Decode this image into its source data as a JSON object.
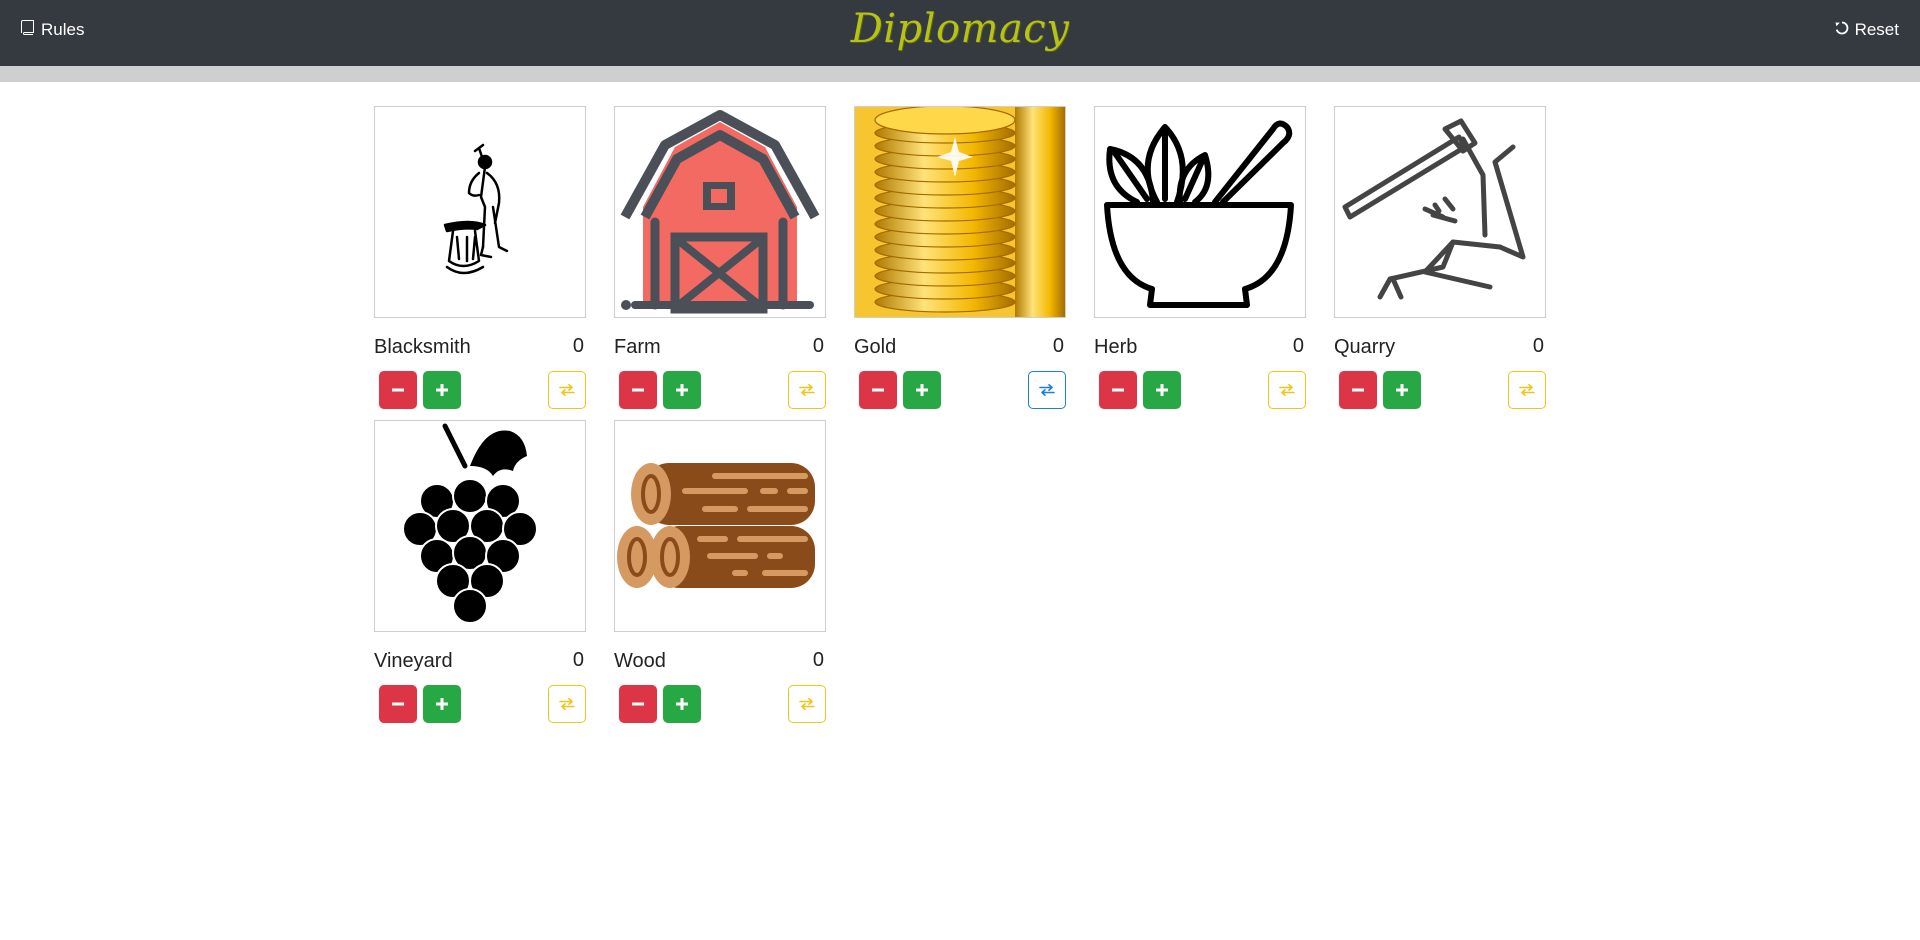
{
  "nav": {
    "rules_label": "Rules",
    "brand_title": "Diplomacy",
    "reset_label": "Reset"
  },
  "colors": {
    "navbar": "#343a40",
    "brand": "#b5c21a",
    "minus": "#dc3545",
    "plus": "#28a745",
    "trade": "#f0c419",
    "trade_active": "#1a7ee0"
  },
  "resources": [
    {
      "name": "Blacksmith",
      "count": "0",
      "icon": "blacksmith-icon",
      "trade_active": false
    },
    {
      "name": "Farm",
      "count": "0",
      "icon": "barn-icon",
      "trade_active": false
    },
    {
      "name": "Gold",
      "count": "0",
      "icon": "gold-coins-icon",
      "trade_active": true
    },
    {
      "name": "Herb",
      "count": "0",
      "icon": "herb-mortar-icon",
      "trade_active": false
    },
    {
      "name": "Quarry",
      "count": "0",
      "icon": "pickaxe-rock-icon",
      "trade_active": false
    },
    {
      "name": "Vineyard",
      "count": "0",
      "icon": "grapes-icon",
      "trade_active": false
    },
    {
      "name": "Wood",
      "count": "0",
      "icon": "logs-icon",
      "trade_active": false
    }
  ]
}
